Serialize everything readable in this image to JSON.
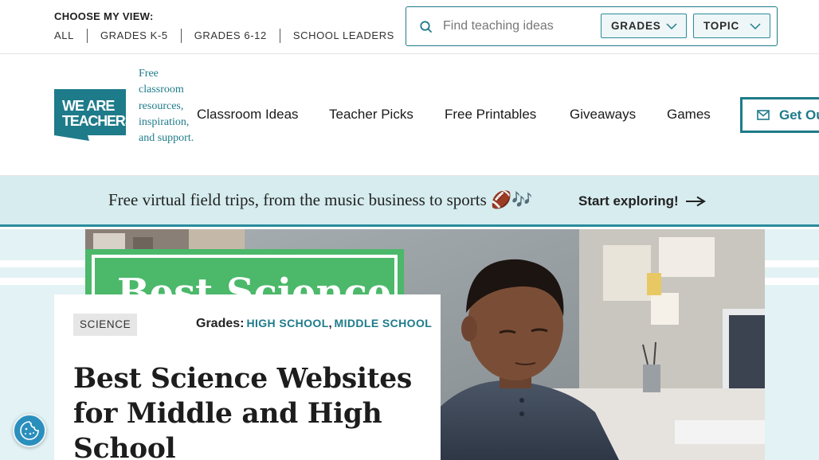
{
  "utility_bar": {
    "view_title": "CHOOSE MY VIEW:",
    "view_links": [
      "ALL",
      "GRADES K-5",
      "GRADES 6-12",
      "SCHOOL LEADERS"
    ],
    "search": {
      "placeholder": "Find teaching ideas",
      "value": "",
      "icon": "search-icon"
    },
    "filters": [
      {
        "label": "GRADES",
        "icon": "chevron-down-icon"
      },
      {
        "label": "TOPIC",
        "icon": "chevron-down-icon"
      }
    ]
  },
  "header": {
    "logo": {
      "line1": "WE ARE",
      "line2": "TEACHERS",
      "color": "#1e7b8a"
    },
    "tagline": "Free classroom resources, inspiration, and support.",
    "nav": [
      "Classroom Ideas",
      "Teacher Picks",
      "Free Printables",
      "Giveaways",
      "Games"
    ],
    "newsletter_button": {
      "label": "Get Ou",
      "icon": "mail-icon"
    }
  },
  "promo": {
    "text": "Free virtual field trips, from the music business to sports 🏈🎶",
    "cta": "Start exploring!",
    "cta_icon": "arrow-right-icon"
  },
  "hero": {
    "image_overlay_text": "Best Science",
    "image_description": "student-at-desk-photo"
  },
  "article": {
    "category": "SCIENCE",
    "grades_label": "Grades:",
    "grades": [
      "HIGH SCHOOL",
      "MIDDLE SCHOOL"
    ],
    "title": "Best Science Websites for Middle and High School"
  },
  "colors": {
    "brand_teal": "#1e7b8a",
    "promo_bg": "#d6ecef",
    "hero_bg": "#e3f2f4",
    "cookie_button": "#2a8fbd"
  },
  "floating": {
    "icon": "cookie-icon"
  }
}
